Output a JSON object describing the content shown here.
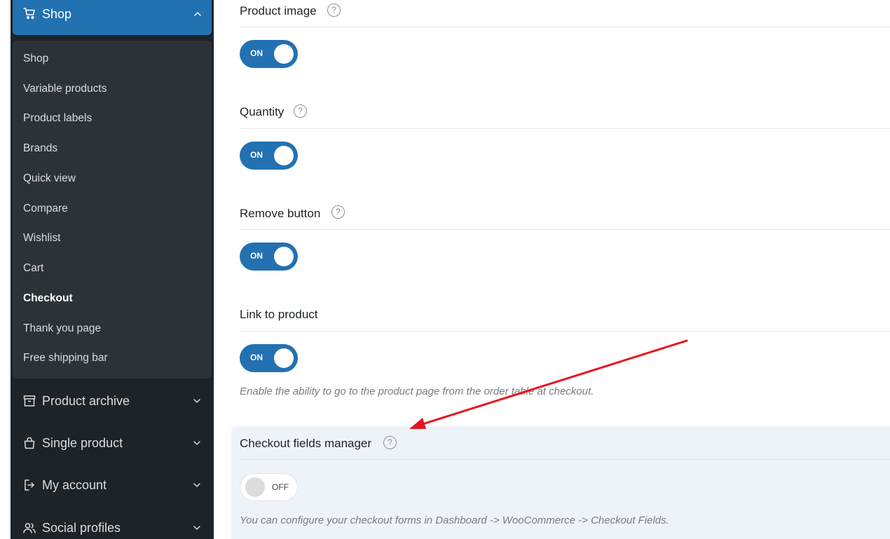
{
  "sidebar": {
    "shop_header": {
      "label": "Shop",
      "icon": "cart-icon"
    },
    "submenu": [
      {
        "label": "Shop",
        "active": false
      },
      {
        "label": "Variable products",
        "active": false
      },
      {
        "label": "Product labels",
        "active": false
      },
      {
        "label": "Brands",
        "active": false
      },
      {
        "label": "Quick view",
        "active": false
      },
      {
        "label": "Compare",
        "active": false
      },
      {
        "label": "Wishlist",
        "active": false
      },
      {
        "label": "Cart",
        "active": false
      },
      {
        "label": "Checkout",
        "active": true
      },
      {
        "label": "Thank you page",
        "active": false
      },
      {
        "label": "Free shipping bar",
        "active": false
      }
    ],
    "sections": [
      {
        "label": "Product archive",
        "icon": "archive-box-icon"
      },
      {
        "label": "Single product",
        "icon": "shopping-bag-icon"
      },
      {
        "label": "My account",
        "icon": "account-login-icon"
      },
      {
        "label": "Social profiles",
        "icon": "users-icon"
      }
    ]
  },
  "settings": [
    {
      "title": "Product image",
      "state": "ON",
      "has_help": true
    },
    {
      "title": "Quantity",
      "state": "ON",
      "has_help": true
    },
    {
      "title": "Remove button",
      "state": "ON",
      "has_help": true
    },
    {
      "title": "Link to product",
      "state": "ON",
      "has_help": false,
      "description": "Enable the ability to go to the product page from the order table at checkout."
    },
    {
      "title": "Checkout fields manager",
      "state": "OFF",
      "has_help": true,
      "description": "You can configure your checkout forms in Dashboard -> WooCommerce -> Checkout Fields."
    }
  ],
  "help_glyph": "?",
  "colors": {
    "accent": "#2271b1",
    "sidebar_bg": "#1d2327",
    "submenu_bg": "#2c3338",
    "highlight_bg": "#eef3fa",
    "annotation_arrow": "#e8141c"
  }
}
